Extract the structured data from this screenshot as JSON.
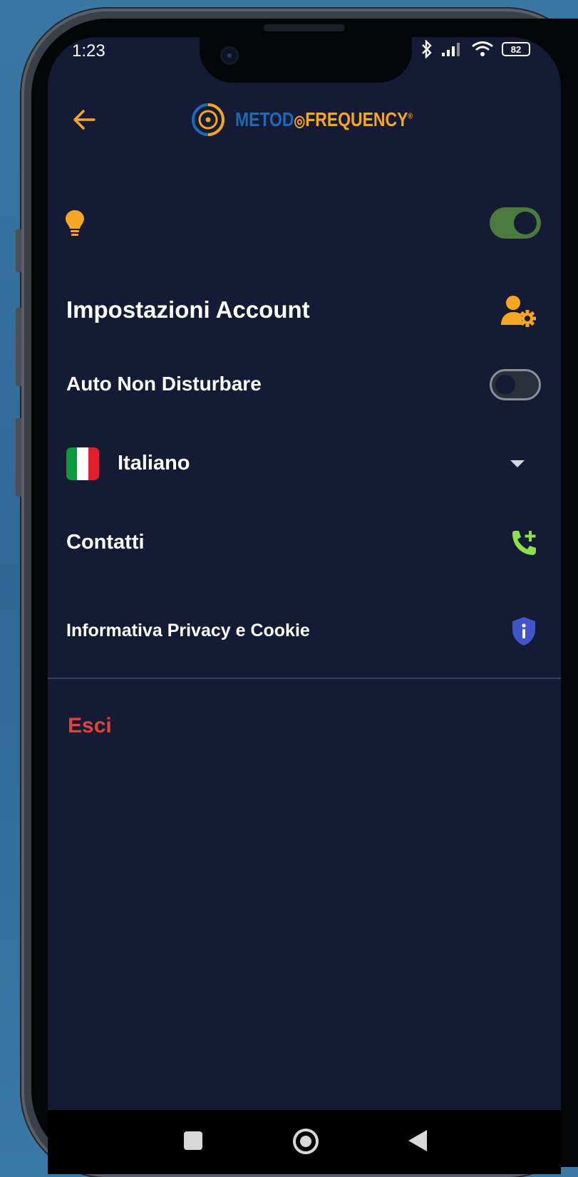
{
  "status_bar": {
    "time": "1:23",
    "battery": "82"
  },
  "header": {
    "logo_part1": "METOD",
    "logo_part2": "FREQUENCY",
    "logo_mark": "®"
  },
  "settings": {
    "theme_toggle_on": true,
    "account_label": "Impostazioni Account",
    "auto_dnd_label": "Auto Non Disturbare",
    "auto_dnd_on": false,
    "language_label": "Italiano",
    "contacts_label": "Contatti",
    "privacy_label": "Informativa Privacy e Cookie",
    "exit_label": "Esci"
  },
  "colors": {
    "background": "#151a35",
    "accent_orange": "#f5a623",
    "toggle_on": "#4b7a3e",
    "contact_green": "#8ee04a",
    "privacy_blue": "#3f55c9",
    "exit_red": "#e3433a"
  },
  "icons": {
    "back": "arrow-left-icon",
    "theme": "lightbulb-icon",
    "account": "user-gear-icon",
    "language": "italy-flag-icon",
    "dropdown": "caret-down-icon",
    "contacts": "phone-plus-icon",
    "privacy": "shield-info-icon"
  }
}
